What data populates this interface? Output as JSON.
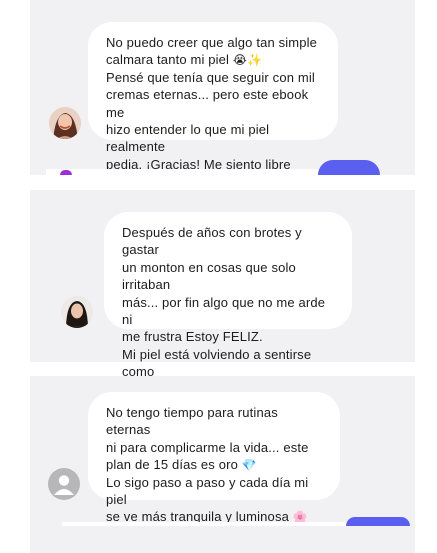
{
  "testimonials": [
    {
      "text": "No puedo creer que algo tan simple\ncalmara tanto mi piel ",
      "emojis": [
        "😭",
        "✨"
      ],
      "text_after": "\nPensé que tenía que seguir con mil\ncremas eternas... pero este ebook me\nhizo entender lo que mi piel realmente\npedia. ¡Gracias! Me siento libre",
      "avatar": "woman-smiling"
    },
    {
      "text": "Después de años con brotes y gastar\nun monton en cosas que solo irritaban\nmás... por fin algo que no me arde ni\nme frustra Estoy FELIZ.\nMi piel está volviendo a sentirse como\nmía ",
      "emojis": [
        "🥹",
        "✨"
      ],
      "text_after": "",
      "avatar": "woman-dark-hair"
    },
    {
      "text": "No tengo tiempo para rutinas eternas\nni para complicarme la vida... este\nplan de 15 días es oro ",
      "emojis": [
        "💎"
      ],
      "text_after": "\nLo sigo paso a paso y cada día mi piel\nse ve más tranquila y luminosa ",
      "emojis2": [
        "🌸"
      ],
      "avatar": "default-user"
    }
  ],
  "colors": {
    "panel": "#f1f1f3",
    "bubble": "#ffffff",
    "accent": "#5a5ff0"
  }
}
